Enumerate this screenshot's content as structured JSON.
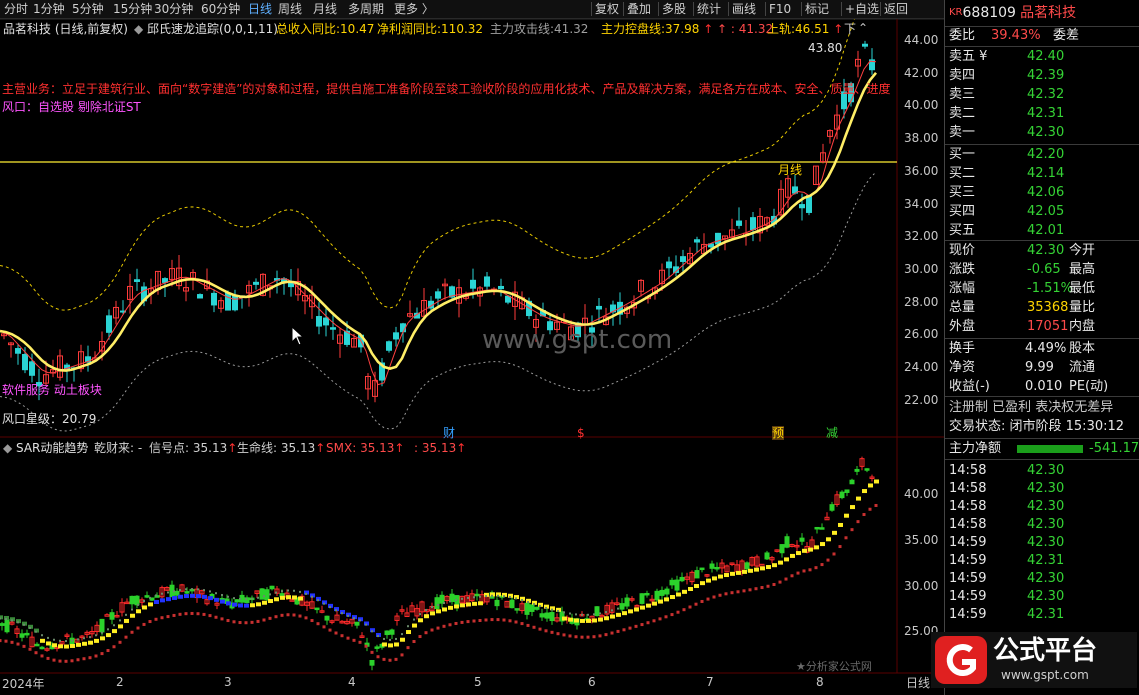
{
  "toolbar": {
    "left_items": [
      "分时",
      "1分钟",
      "5分钟",
      "15分钟",
      "30分钟",
      "60分钟",
      "日线",
      "周线",
      "月线",
      "多周期",
      "更多 〉"
    ],
    "active_item": "日线",
    "right_items": [
      "复权",
      "叠加",
      "多股",
      "统计",
      "画线",
      "F10",
      "标记",
      "+自选",
      "返回"
    ]
  },
  "main_chart": {
    "title": "品茗科技 (日线,前复权)",
    "indicator": "邱氏速龙追踪(0,0,1,11)",
    "stats": [
      {
        "label": "总收入同比:",
        "value": "10.47",
        "color": "#ffd400"
      },
      {
        "label": "净利润同比:",
        "value": "110.32",
        "color": "#ffd400"
      },
      {
        "label": "主力攻击线:",
        "value": "41.32",
        "color": "#a0a0a0"
      },
      {
        "label": "主力控盘线:",
        "value": "37.98",
        "color": "#ffd400"
      },
      {
        "label": "",
        "value": "41.32",
        "color": "#ff4a4a"
      },
      {
        "label": "上轨:",
        "value": "46.51",
        "color": "#ffd400"
      }
    ],
    "business": "主营业务：立足于建筑行业、面向“数字建造”的对象和过程，提供自施工准备阶段至竣工验收阶段的应用化技术、产品及解决方案，满足各方在成本、安全、质量、进度",
    "wind_line": "风口：自选股  剔除北证ST",
    "wind_rating": "风口星级：20.79",
    "sector_tag": "软件服务 动土板块",
    "price_high_label": "43.80",
    "marker_moon": "月线",
    "markers": [
      "财",
      "$",
      "预",
      "减"
    ],
    "y_ticks": [
      "44.00",
      "42.00",
      "40.00",
      "38.00",
      "36.00",
      "34.00",
      "32.00",
      "30.00",
      "28.00",
      "26.00",
      "24.00",
      "22.00"
    ],
    "watermark": "www.gspt.com",
    "down_label": "下"
  },
  "sub_chart": {
    "indicator": "SAR动能趋势",
    "items": [
      {
        "label": "乾财来:",
        "value": "-",
        "color": "#d0d0d0"
      },
      {
        "label": "信号点:",
        "value": "35.13",
        "color": "#d0d0d0"
      },
      {
        "label": "生命线:",
        "value": "35.13",
        "color": "#d0d0d0"
      },
      {
        "label": "SMX:",
        "value": "35.13",
        "color": "#ff4a4a"
      },
      {
        "label": "",
        "value": "35.13",
        "color": "#ff4a4a"
      }
    ],
    "y_ticks": [
      "40.00",
      "35.00",
      "30.00",
      "25.00"
    ],
    "footer": "★分析家公式网"
  },
  "x_axis": [
    "2024年",
    "2",
    "3",
    "4",
    "5",
    "6",
    "7",
    "8"
  ],
  "x_axis_right": "日线",
  "quote": {
    "code_prefix": "KR",
    "code": "688109",
    "name": "品茗科技",
    "weibi_label": "委比",
    "weibi_value": "39.43%",
    "weicha_label": "委差",
    "asks": [
      {
        "label": "卖五 ¥",
        "price": "42.40"
      },
      {
        "label": "卖四",
        "price": "42.39"
      },
      {
        "label": "卖三",
        "price": "42.32"
      },
      {
        "label": "卖二",
        "price": "42.31"
      },
      {
        "label": "卖一",
        "price": "42.30"
      }
    ],
    "bids": [
      {
        "label": "买一",
        "price": "42.20"
      },
      {
        "label": "买二",
        "price": "42.14"
      },
      {
        "label": "买三",
        "price": "42.06"
      },
      {
        "label": "买四",
        "price": "42.05"
      },
      {
        "label": "买五",
        "price": "42.01"
      }
    ],
    "stats": [
      {
        "l": "现价",
        "v": "42.30",
        "v_color": "#35d335",
        "r": "今开"
      },
      {
        "l": "涨跌",
        "v": "-0.65",
        "v_color": "#35d335",
        "r": "最高"
      },
      {
        "l": "涨幅",
        "v": "-1.51%",
        "v_color": "#35d335",
        "r": "最低"
      },
      {
        "l": "总量",
        "v": "35368",
        "v_color": "#ffd400",
        "r": "量比"
      },
      {
        "l": "外盘",
        "v": "17051",
        "v_color": "#ff4a4a",
        "r": "内盘"
      }
    ],
    "stats2": [
      {
        "l": "换手",
        "v": "4.49%",
        "r": "股本"
      },
      {
        "l": "净资",
        "v": "9.99",
        "r": "流通"
      },
      {
        "l": "收益(-)",
        "v": "0.010",
        "r": "PE(动)"
      }
    ],
    "reg_line": "注册制 已盈利 表决权无差异",
    "trade_status": "交易状态: 闭市阶段 15:30:12",
    "net_label": "主力净额",
    "net_value": "-541.17",
    "ticks": [
      {
        "t": "14:58",
        "p": "42.30"
      },
      {
        "t": "14:58",
        "p": "42.30"
      },
      {
        "t": "14:58",
        "p": "42.30"
      },
      {
        "t": "14:58",
        "p": "42.30"
      },
      {
        "t": "14:59",
        "p": "42.30"
      },
      {
        "t": "14:59",
        "p": "42.31"
      },
      {
        "t": "14:59",
        "p": "42.30"
      },
      {
        "t": "14:59",
        "p": "42.30"
      },
      {
        "t": "14:59",
        "p": "42.31"
      }
    ]
  },
  "brand": {
    "name": "公式平台",
    "url": "www.gspt.com"
  },
  "colors": {
    "up": "#ff3b3b",
    "down": "#2ad4d4",
    "ma_main": "#ffee66",
    "band": "#e6c800",
    "ma_thin": "#ff4040"
  }
}
